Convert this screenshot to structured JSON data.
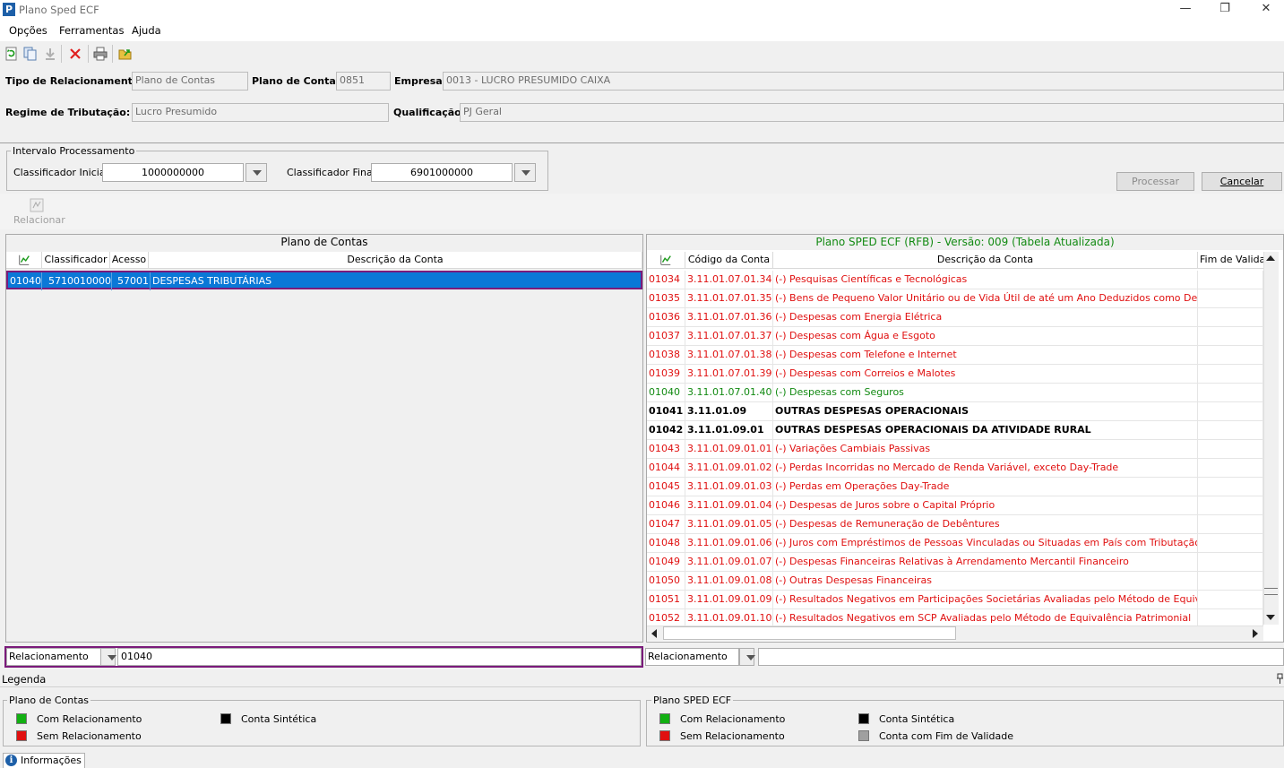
{
  "window": {
    "title": "Plano Sped ECF",
    "app_icon": "P",
    "buttons": {
      "minimize": "—",
      "maximize": "❐",
      "close": "✕"
    }
  },
  "menu": [
    "Opções",
    "Ferramentas",
    "Ajuda"
  ],
  "header": {
    "tipo_label": "Tipo de Relacionamento:",
    "tipo_value": "Plano de Contas",
    "plano_label": "Plano de Contas:",
    "plano_value": "0851",
    "empresa_label": "Empresa:",
    "empresa_value": "0013 - LUCRO PRESUMIDO CAIXA",
    "regime_label": "Regime de Tributação:",
    "regime_value": "Lucro Presumido",
    "qualificacao_label": "Qualificação:",
    "qualificacao_value": "PJ Geral"
  },
  "intervalo": {
    "title": "Intervalo Processamento",
    "inicial_label": "Classificador Inicial:",
    "inicial_value": "1000000000",
    "final_label": "Classificador Final:",
    "final_value": "6901000000"
  },
  "actions": {
    "processar": "Processar",
    "cancelar": "Cancelar",
    "relacionar": "Relacionar"
  },
  "left_grid": {
    "title": "Plano de Contas",
    "columns": [
      "Classificador",
      "Acesso",
      "Descrição da Conta"
    ],
    "rows": [
      {
        "id": "01040",
        "classificador": "5710010000",
        "acesso": "57001",
        "descricao": "DESPESAS TRIBUTÁRIAS"
      }
    ]
  },
  "right_grid": {
    "title": "Plano SPED ECF (RFB) - Versão: 009 (Tabela Atualizada)",
    "columns": [
      "Código da Conta",
      "Descrição da Conta",
      "Fim de Validade"
    ],
    "rows": [
      {
        "id": "01034",
        "codigo": "3.11.01.07.01.34",
        "descricao": "(-) Pesquisas Científicas e Tecnológicas",
        "status": "red"
      },
      {
        "id": "01035",
        "codigo": "3.11.01.07.01.35",
        "descricao": "(-) Bens de Pequeno Valor Unitário ou de Vida Útil de até um Ano Deduzidos como Despesa",
        "status": "red"
      },
      {
        "id": "01036",
        "codigo": "3.11.01.07.01.36",
        "descricao": "(-) Despesas com Energia Elétrica",
        "status": "red"
      },
      {
        "id": "01037",
        "codigo": "3.11.01.07.01.37",
        "descricao": "(-) Despesas com Água e Esgoto",
        "status": "red"
      },
      {
        "id": "01038",
        "codigo": "3.11.01.07.01.38",
        "descricao": "(-) Despesas com Telefone e Internet",
        "status": "red"
      },
      {
        "id": "01039",
        "codigo": "3.11.01.07.01.39",
        "descricao": "(-) Despesas com Correios e Malotes",
        "status": "red"
      },
      {
        "id": "01040",
        "codigo": "3.11.01.07.01.40",
        "descricao": "(-) Despesas com Seguros",
        "status": "green"
      },
      {
        "id": "01041",
        "codigo": "3.11.01.09",
        "descricao": "OUTRAS DESPESAS OPERACIONAIS",
        "status": "black"
      },
      {
        "id": "01042",
        "codigo": "3.11.01.09.01",
        "descricao": "OUTRAS DESPESAS OPERACIONAIS DA ATIVIDADE RURAL",
        "status": "black"
      },
      {
        "id": "01043",
        "codigo": "3.11.01.09.01.01",
        "descricao": "(-) Variações Cambiais Passivas",
        "status": "red"
      },
      {
        "id": "01044",
        "codigo": "3.11.01.09.01.02",
        "descricao": "(-) Perdas Incorridas no Mercado de Renda Variável, exceto Day-Trade",
        "status": "red"
      },
      {
        "id": "01045",
        "codigo": "3.11.01.09.01.03",
        "descricao": "(-) Perdas em Operações Day-Trade",
        "status": "red"
      },
      {
        "id": "01046",
        "codigo": "3.11.01.09.01.04",
        "descricao": "(-) Despesas de Juros sobre o Capital Próprio",
        "status": "red"
      },
      {
        "id": "01047",
        "codigo": "3.11.01.09.01.05",
        "descricao": "(-) Despesas de Remuneração de Debêntures",
        "status": "red"
      },
      {
        "id": "01048",
        "codigo": "3.11.01.09.01.06",
        "descricao": "(-) Juros com Empréstimos de Pessoas Vinculadas ou Situadas em País com Tributação favorecida",
        "status": "red"
      },
      {
        "id": "01049",
        "codigo": "3.11.01.09.01.07",
        "descricao": "(-) Despesas Financeiras Relativas à Arrendamento Mercantil Financeiro",
        "status": "red"
      },
      {
        "id": "01050",
        "codigo": "3.11.01.09.01.08",
        "descricao": "(-) Outras Despesas Financeiras",
        "status": "red"
      },
      {
        "id": "01051",
        "codigo": "3.11.01.09.01.09",
        "descricao": "(-) Resultados Negativos em Participações Societárias Avaliadas pelo Método de Equivalência Patri",
        "status": "red"
      },
      {
        "id": "01052",
        "codigo": "3.11.01.09.01.10",
        "descricao": "(-) Resultados Negativos em SCP Avaliadas pelo Método de Equivalência Patrimonial",
        "status": "red"
      }
    ]
  },
  "filter_left": {
    "combo": "Relacionamento",
    "value": "01040"
  },
  "filter_right": {
    "combo": "Relacionamento",
    "value": ""
  },
  "legenda": {
    "title": "Legenda",
    "left": {
      "title": "Plano de Contas",
      "com": "Com Relacionamento",
      "sem": "Sem Relacionamento",
      "sintetica": "Conta Sintética"
    },
    "right": {
      "title": "Plano SPED ECF",
      "com": "Com Relacionamento",
      "sem": "Sem Relacionamento",
      "sintetica": "Conta Sintética",
      "fim": "Conta com Fim de Validade"
    },
    "colors": {
      "com": "#12b012",
      "sem": "#e01010",
      "sintetica": "#000000",
      "fim": "#a0a0a0"
    }
  },
  "status_tab": "Informações"
}
